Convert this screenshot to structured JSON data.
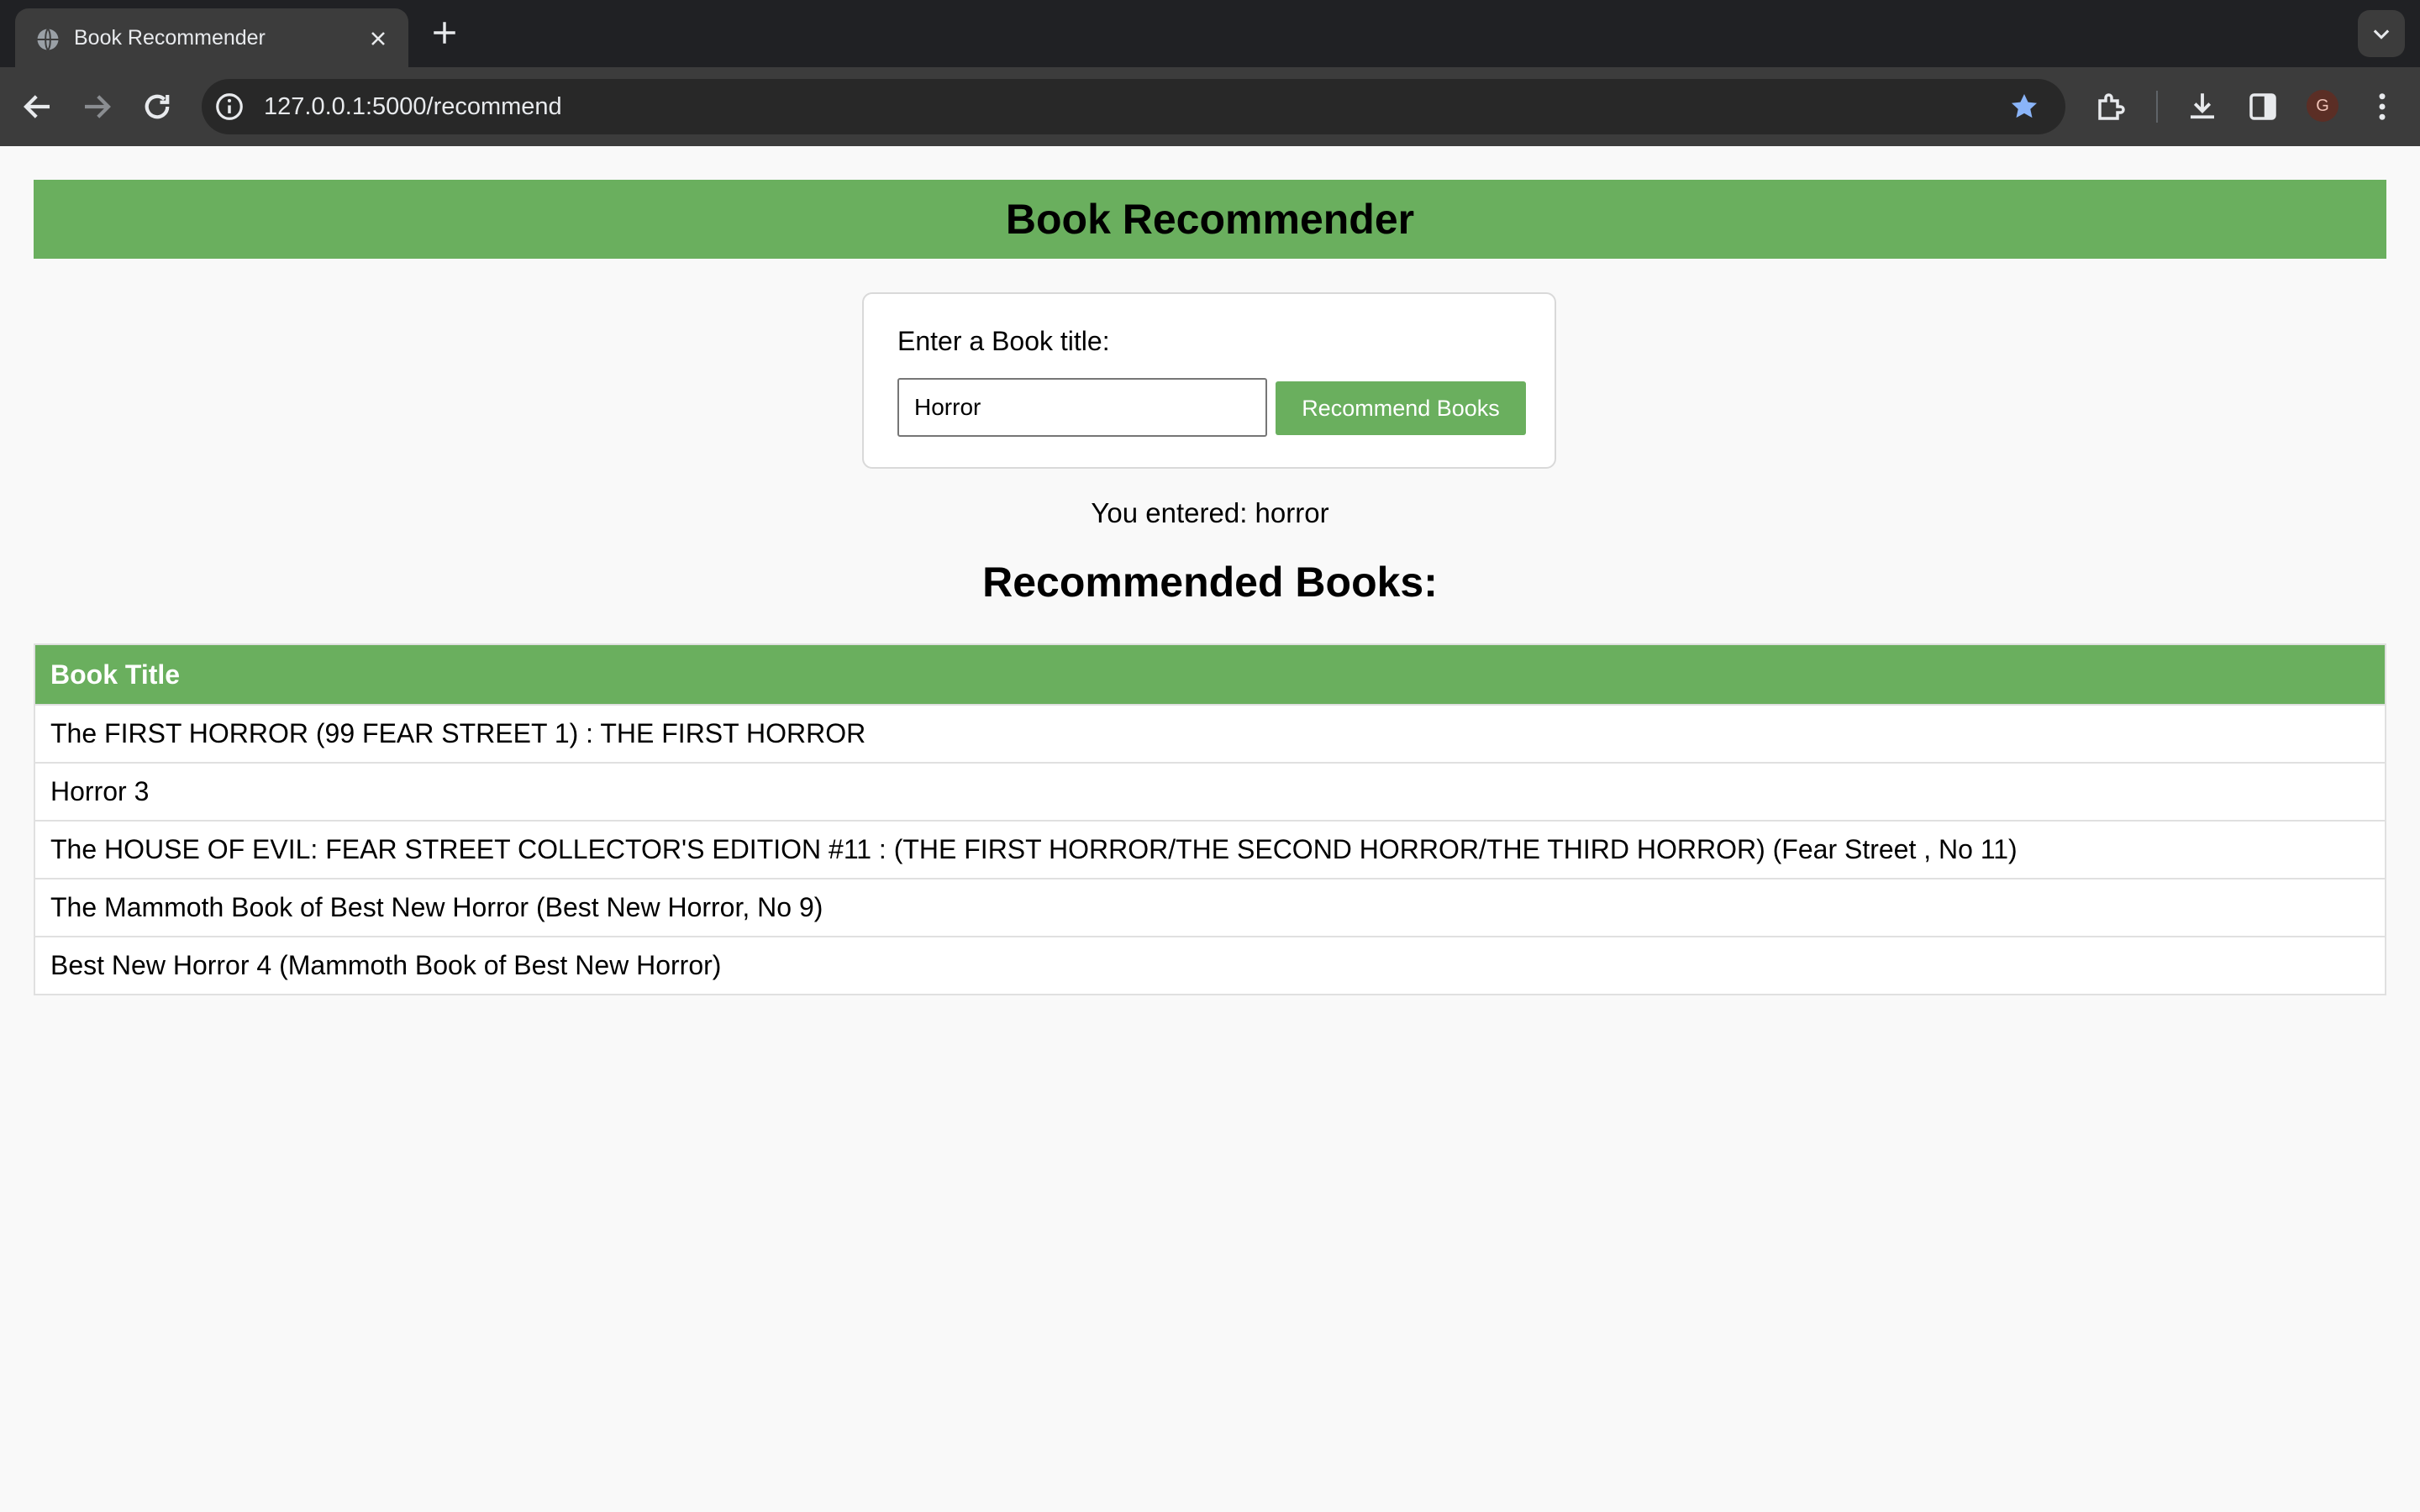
{
  "browser": {
    "tab_title": "Book Recommender",
    "url": "127.0.0.1:5000/recommend",
    "profile_initial": "G"
  },
  "app": {
    "title": "Book Recommender",
    "form": {
      "label": "Enter a Book title:",
      "input_value": "Horror",
      "button_label": "Recommend Books"
    },
    "entered_text": "You entered: horror",
    "results_heading": "Recommended Books:",
    "table": {
      "header": "Book Title",
      "rows": [
        "The FIRST HORROR (99 FEAR STREET 1) : THE FIRST HORROR",
        "Horror 3",
        "The HOUSE OF EVIL: FEAR STREET COLLECTOR'S EDITION #11 : (THE FIRST HORROR/THE SECOND HORROR/THE THIRD HORROR) (Fear Street , No 11)",
        "The Mammoth Book of Best New Horror (Best New Horror, No 9)",
        "Best New Horror 4 (Mammoth Book of Best New Horror)"
      ]
    }
  },
  "colors": {
    "accent_green": "#6aaf5e",
    "chrome_dark": "#202124",
    "toolbar": "#3c3c3c",
    "bookmark_star": "#8ab4f8"
  }
}
